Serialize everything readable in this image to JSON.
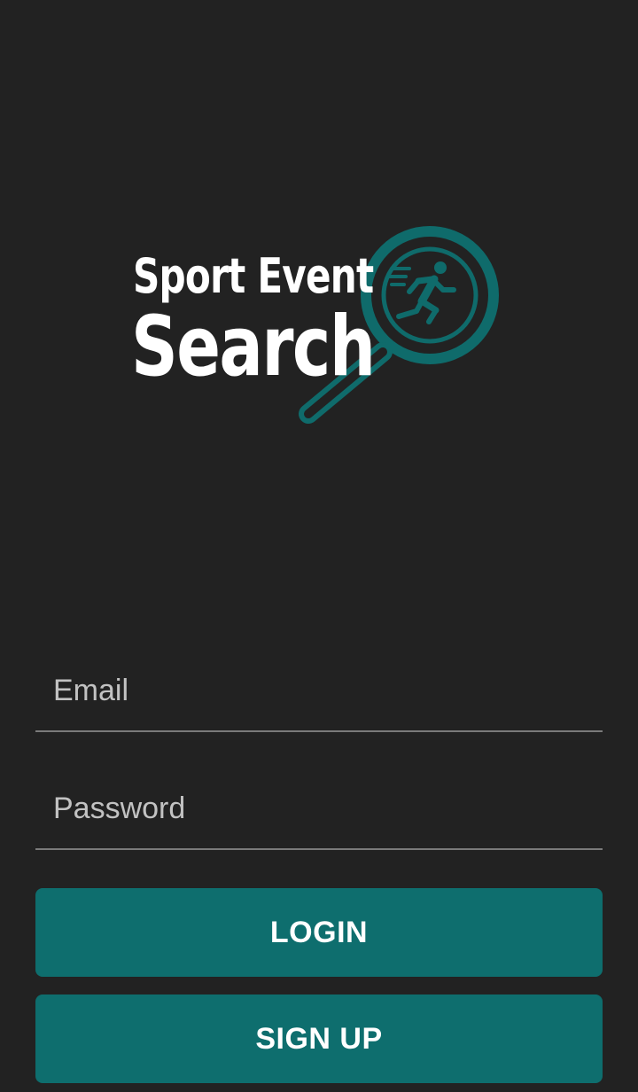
{
  "theme": {
    "background": "#222222",
    "accent": "#0e6e6e",
    "logo_accent": "#0f6b6b",
    "text_primary": "#ffffff",
    "placeholder": "#c2c2c2",
    "underline": "#7a7a7a"
  },
  "logo": {
    "line1": "Sport Event",
    "line2": "Search",
    "icon": "magnifier-runner-icon"
  },
  "form": {
    "email_placeholder": "Email",
    "email_value": "",
    "password_placeholder": "Password",
    "password_value": ""
  },
  "buttons": {
    "login_label": "LOGIN",
    "signup_label": "SIGN UP"
  }
}
